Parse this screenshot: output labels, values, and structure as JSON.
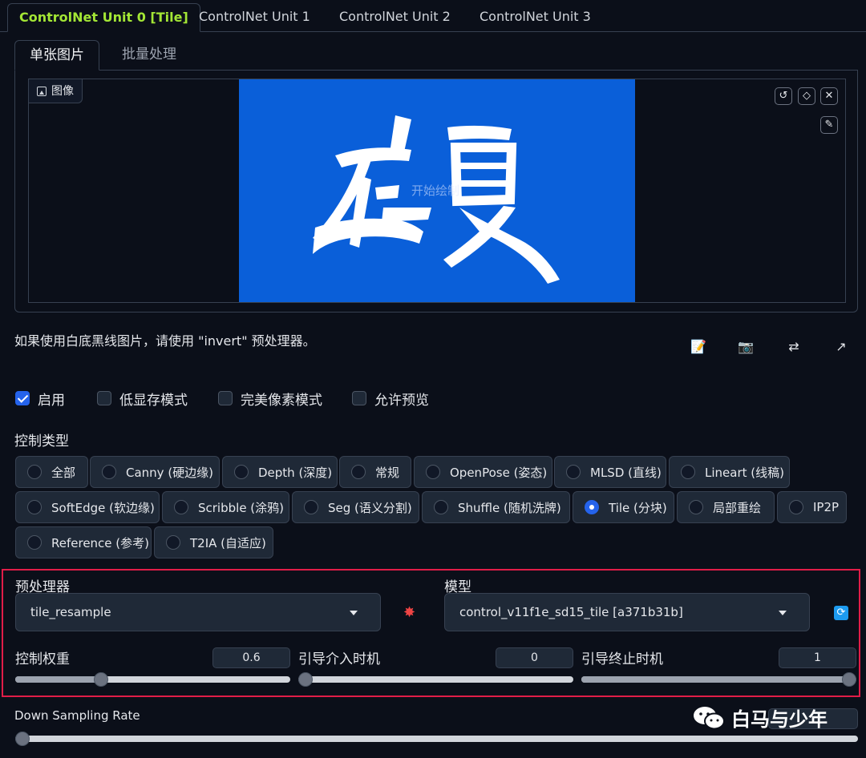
{
  "unit_tabs": [
    "ControlNet Unit 0 [Tile]",
    "ControlNet Unit 1",
    "ControlNet Unit 2",
    "ControlNet Unit 3"
  ],
  "sub_tabs": [
    "单张图片",
    "批量处理"
  ],
  "image_panel": {
    "label": "图像",
    "watermark": "开始绘制",
    "art_text": "盛夏"
  },
  "hint": "如果使用白底黑线图片，请使用 \"invert\" 预处理器。",
  "checkboxes": [
    {
      "label": "启用",
      "checked": true
    },
    {
      "label": "低显存模式",
      "checked": false
    },
    {
      "label": "完美像素模式",
      "checked": false
    },
    {
      "label": "允许预览",
      "checked": false
    }
  ],
  "control_type_label": "控制类型",
  "control_types": [
    {
      "label": "全部",
      "selected": false
    },
    {
      "label": "Canny (硬边缘)",
      "selected": false
    },
    {
      "label": "Depth (深度)",
      "selected": false
    },
    {
      "label": "常规",
      "selected": false
    },
    {
      "label": "OpenPose (姿态)",
      "selected": false
    },
    {
      "label": "MLSD (直线)",
      "selected": false
    },
    {
      "label": "Lineart (线稿)",
      "selected": false
    },
    {
      "label": "SoftEdge (软边缘)",
      "selected": false
    },
    {
      "label": "Scribble (涂鸦)",
      "selected": false
    },
    {
      "label": "Seg (语义分割)",
      "selected": false
    },
    {
      "label": "Shuffle (随机洗牌)",
      "selected": false
    },
    {
      "label": "Tile (分块)",
      "selected": true
    },
    {
      "label": "局部重绘",
      "selected": false
    },
    {
      "label": "IP2P",
      "selected": false
    },
    {
      "label": "Reference (参考)",
      "selected": false
    },
    {
      "label": "T2IA (自适应)",
      "selected": false
    }
  ],
  "preprocessor": {
    "label": "预处理器",
    "value": "tile_resample"
  },
  "model": {
    "label": "模型",
    "value": "control_v11f1e_sd15_tile [a371b31b]"
  },
  "sliders": {
    "weight": {
      "label": "控制权重",
      "value": "0.6",
      "fraction": 0.3
    },
    "start": {
      "label": "引导介入时机",
      "value": "0",
      "fraction": 0.0
    },
    "end": {
      "label": "引导终止时机",
      "value": "1",
      "fraction": 1.0
    }
  },
  "down_sampling": {
    "label": "Down Sampling Rate",
    "fraction": 0.0
  },
  "watermark_brand": "白马与少年"
}
